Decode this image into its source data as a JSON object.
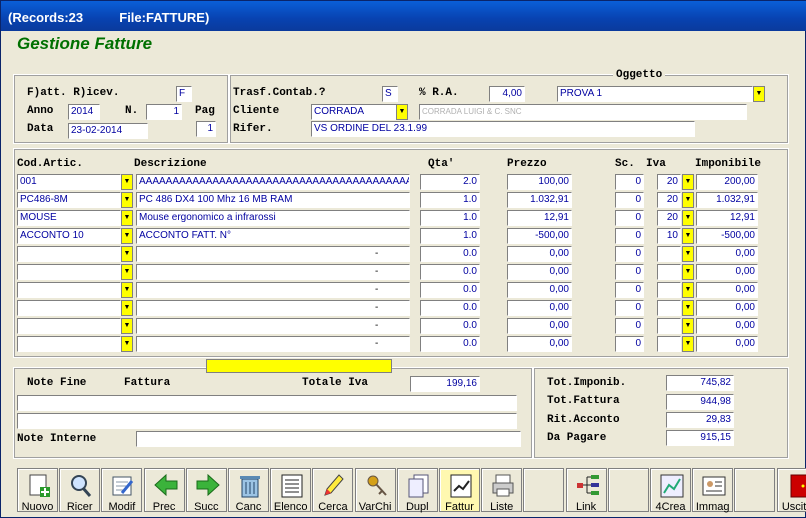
{
  "window": {
    "title": "(Records:23          File:FATTURE)"
  },
  "app": {
    "title": "Gestione Fatture"
  },
  "header": {
    "fattura_label": "F)att. R)icev.",
    "fattura_value": "F",
    "anno_label": "Anno",
    "anno_value": "2014",
    "n_label": "N.",
    "n_value": "1",
    "pag_label": "Pag",
    "pag_value": "1",
    "data_label": "Data",
    "data_value": "23-02-2014",
    "trasf_label": "Trasf.Contab.?",
    "trasf_value": "S",
    "ra_label": "% R.A.",
    "ra_value": "4,00",
    "oggetto_label": "Oggetto",
    "oggetto_value": "PROVA 1",
    "cliente_label": "Cliente",
    "cliente_code": "CORRADA",
    "cliente_name": "CORRADA LUIGI & C. SNC",
    "rifer_label": "Rifer.",
    "rifer_value": "VS ORDINE DEL 23.1.99"
  },
  "grid": {
    "headers": {
      "cod": "Cod.Artic.",
      "desc": "Descrizione",
      "qta": "Qta'",
      "prezzo": "Prezzo",
      "sc": "Sc.",
      "iva": "Iva",
      "imponibile": "Imponibile"
    },
    "rows": [
      {
        "cod": "001",
        "desc": "AAAAAAAAAAAAAAAAAAAAAAAAAAAAAAAAAAAAAAAAAAAAAAAAAA",
        "qta": "2.0",
        "prezzo": "100,00",
        "sc": "0",
        "iva": "20",
        "imp": "200,00"
      },
      {
        "cod": "PC486-8M",
        "desc": "PC 486 DX4 100 Mhz 16 MB RAM",
        "qta": "1.0",
        "prezzo": "1.032,91",
        "sc": "0",
        "iva": "20",
        "imp": "1.032,91"
      },
      {
        "cod": "MOUSE",
        "desc": "Mouse ergonomico a infrarossi",
        "qta": "1.0",
        "prezzo": "12,91",
        "sc": "0",
        "iva": "20",
        "imp": "12,91"
      },
      {
        "cod": "ACCONTO 10",
        "desc": "ACCONTO FATT. N°",
        "qta": "1.0",
        "prezzo": "-500,00",
        "sc": "0",
        "iva": "10",
        "imp": "-500,00"
      },
      {
        "cod": "",
        "desc": "",
        "qta": "0.0",
        "prezzo": "0,00",
        "sc": "0",
        "iva": "",
        "imp": "0,00"
      },
      {
        "cod": "",
        "desc": "",
        "qta": "0.0",
        "prezzo": "0,00",
        "sc": "0",
        "iva": "",
        "imp": "0,00"
      },
      {
        "cod": "",
        "desc": "",
        "qta": "0.0",
        "prezzo": "0,00",
        "sc": "0",
        "iva": "",
        "imp": "0,00"
      },
      {
        "cod": "",
        "desc": "",
        "qta": "0.0",
        "prezzo": "0,00",
        "sc": "0",
        "iva": "",
        "imp": "0,00"
      },
      {
        "cod": "",
        "desc": "",
        "qta": "0.0",
        "prezzo": "0,00",
        "sc": "0",
        "iva": "",
        "imp": "0,00"
      },
      {
        "cod": "",
        "desc": "",
        "qta": "0.0",
        "prezzo": "0,00",
        "sc": "0",
        "iva": "",
        "imp": "0,00"
      }
    ],
    "empty_desc_mark": "-"
  },
  "footer": {
    "note_fine_label": "Note Fine",
    "fattura_label": "Fattura",
    "totale_iva_label": "Totale Iva",
    "totale_iva_value": "199,16",
    "note_interne_label": "Note Interne",
    "tot_imponib_label": "Tot.Imponib.",
    "tot_imponib_value": "745,82",
    "tot_fattura_label": "Tot.Fattura",
    "tot_fattura_value": "944,98",
    "rit_acconto_label": "Rit.Acconto",
    "rit_acconto_value": "29,83",
    "da_pagare_label": "Da Pagare",
    "da_pagare_value": "915,15"
  },
  "toolbar": [
    {
      "label": "Nuovo",
      "icon": "new-doc-icon"
    },
    {
      "label": "Ricer",
      "icon": "search-icon"
    },
    {
      "label": "Modif",
      "icon": "edit-icon"
    },
    {
      "label": "Prec",
      "icon": "arrow-left-icon"
    },
    {
      "label": "Succ",
      "icon": "arrow-right-icon"
    },
    {
      "label": "Canc",
      "icon": "trash-icon"
    },
    {
      "label": "Elenco",
      "icon": "list-icon"
    },
    {
      "label": "Cerca",
      "icon": "highlighter-icon"
    },
    {
      "label": "VarChi",
      "icon": "keys-icon"
    },
    {
      "label": "Dupl",
      "icon": "duplicate-icon"
    },
    {
      "label": "Fattur",
      "icon": "invoice-icon"
    },
    {
      "label": "Liste",
      "icon": "printer-icon"
    },
    {
      "label": "",
      "icon": ""
    },
    {
      "label": "Link",
      "icon": "link-tree-icon"
    },
    {
      "label": "",
      "icon": ""
    },
    {
      "label": "4Crea",
      "icon": "chart-icon"
    },
    {
      "label": "Immag",
      "icon": "image-card-icon"
    },
    {
      "label": "",
      "icon": ""
    },
    {
      "label": "Uscita",
      "icon": "exit-door-icon"
    }
  ]
}
